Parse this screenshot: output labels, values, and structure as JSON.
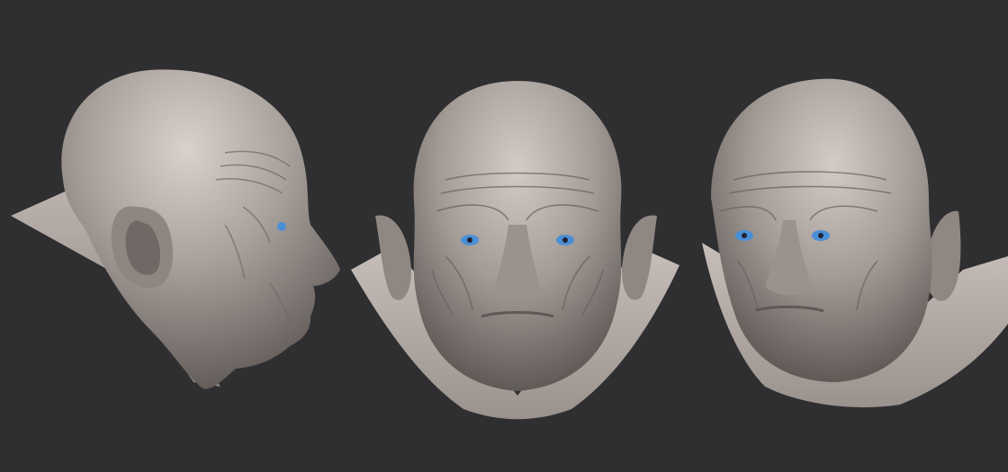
{
  "scene": {
    "background_color": "#2f2f31",
    "material_color": "#a79e99",
    "eye_color": "#4a8fd6",
    "views": [
      {
        "name": "side-profile"
      },
      {
        "name": "front"
      },
      {
        "name": "three-quarter"
      }
    ]
  }
}
